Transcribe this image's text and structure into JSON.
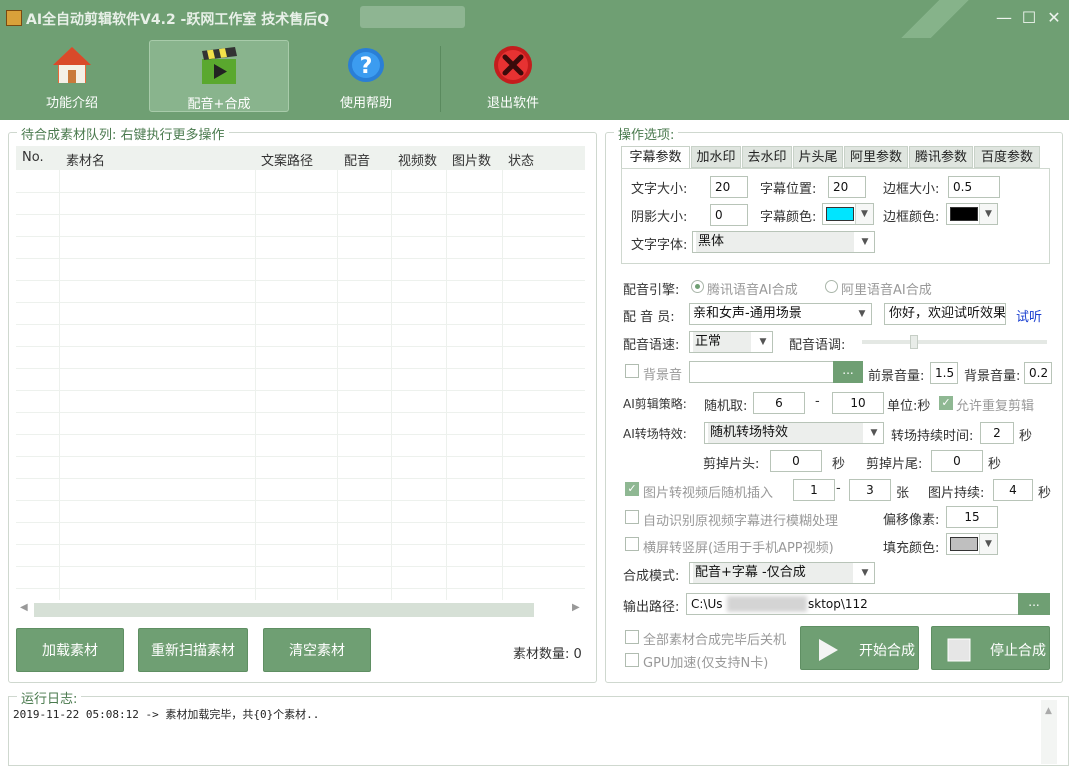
{
  "app": {
    "title": "AI全自动剪辑软件V4.2 -跃网工作室 技术售后Q",
    "window_controls": [
      "—",
      "☐",
      "✕"
    ]
  },
  "toolbar": [
    {
      "label": "功能介绍",
      "icon": "home-icon"
    },
    {
      "label": "配音+合成",
      "icon": "clapperboard-icon",
      "active": true
    },
    {
      "label": "使用帮助",
      "icon": "help-icon"
    },
    {
      "label": "退出软件",
      "icon": "exit-icon"
    }
  ],
  "queue": {
    "title": "待合成素材队列: 右键执行更多操作",
    "columns": [
      "No.",
      "素材名",
      "文案路径",
      "配音",
      "视频数",
      "图片数",
      "状态"
    ],
    "rows": [],
    "buttons": {
      "load": "加载素材",
      "rescan": "重新扫描素材",
      "clear": "清空素材"
    },
    "count_label": "素材数量: 0"
  },
  "options": {
    "title": "操作选项:",
    "tabs": [
      "字幕参数",
      "加水印",
      "去水印",
      "片头尾",
      "阿里参数",
      "腾讯参数",
      "百度参数"
    ],
    "subtitle": {
      "font_size_label": "文字大小:",
      "font_size": "20",
      "position_label": "字幕位置:",
      "position": "20",
      "border_size_label": "边框大小:",
      "border_size": "0.5",
      "shadow_label": "阴影大小:",
      "shadow": "0",
      "color_label": "字幕颜色:",
      "color": "#00e5ff",
      "border_color_label": "边框颜色:",
      "border_color": "#000000",
      "font_label": "文字字体:",
      "font": "黑体"
    },
    "engine_label": "配音引擎:",
    "engine_options": [
      "腾讯语音AI合成",
      "阿里语音AI合成"
    ],
    "voice_label": "配 音 员:",
    "voice": "亲和女声-通用场景",
    "preview_text": "你好，欢迎试听效果",
    "listen": "试听",
    "speed_label": "配音语速:",
    "speed": "正常",
    "tone_label": "配音语调:",
    "bgm_label": "背景音",
    "bgm_browse": "...",
    "fg_volume_label": "前景音量:",
    "fg_volume": "1.5",
    "bg_volume_label": "背景音量:",
    "bg_volume": "0.2",
    "strategy_label": "AI剪辑策略:",
    "random_label": "随机取:",
    "random_min": "6",
    "range_sep": "-",
    "random_max": "10",
    "unit_label": "单位:秒",
    "allow_repeat": "允许重复剪辑",
    "transition_label": "AI转场特效:",
    "transition": "随机转场特效",
    "transition_time_label": "转场持续时间:",
    "transition_time": "2",
    "sec": "秒",
    "cut_head_label": "剪掉片头:",
    "cut_head": "0",
    "cut_tail_label": "剪掉片尾:",
    "cut_tail": "0",
    "img_insert_label": "图片转视频后随机插入",
    "img_min": "1",
    "img_max": "3",
    "img_unit": "张",
    "img_duration_label": "图片持续:",
    "img_duration": "4",
    "blur_sub_label": "自动识别原视频字幕进行模糊处理",
    "offset_label": "偏移像素:",
    "offset": "15",
    "vertical_label": "横屏转竖屏(适用于手机APP视频)",
    "fill_color_label": "填充颜色:",
    "mode_label": "合成模式:",
    "mode": "配音+字幕 -仅合成",
    "output_label": "输出路径:",
    "output_path_start": "C:\\Us",
    "output_path_end": "sktop\\112",
    "output_browse": "...",
    "shutdown_label": "全部素材合成完毕后关机",
    "gpu_label": "GPU加速(仅支持N卡)",
    "start_label": "开始合成",
    "stop_label": "停止合成"
  },
  "log": {
    "title": "运行日志:",
    "lines": [
      "2019-11-22 05:08:12 -> 素材加载完毕，共{0}个素材.."
    ]
  }
}
